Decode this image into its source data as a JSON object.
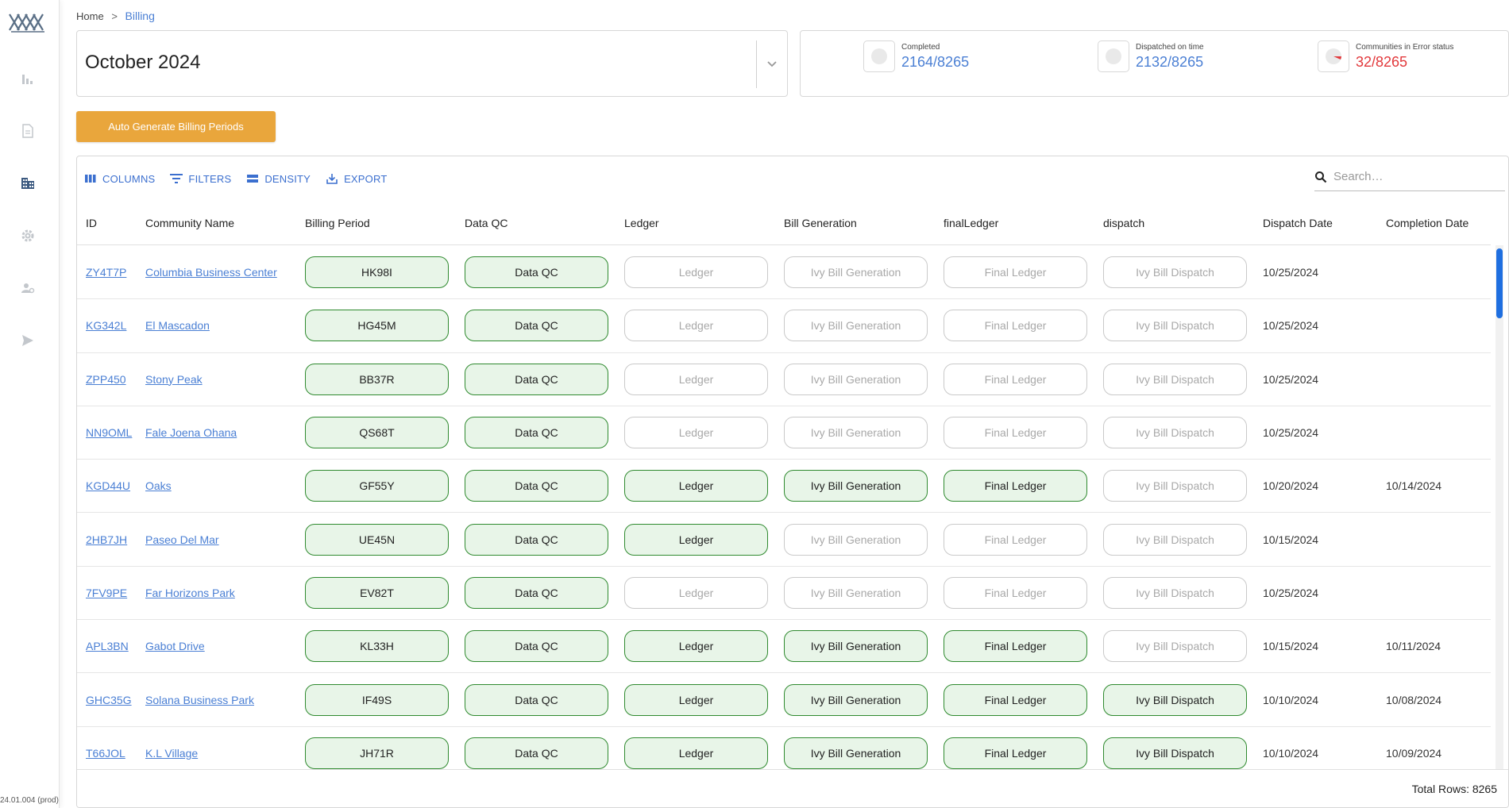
{
  "app": {
    "version": "24.01.004 (prod)"
  },
  "sidebar": {
    "items": [
      {
        "icon": "bar-chart-icon"
      },
      {
        "icon": "document-icon"
      },
      {
        "icon": "building-icon"
      },
      {
        "icon": "gear-icon"
      },
      {
        "icon": "user-settings-icon"
      },
      {
        "icon": "send-icon"
      }
    ]
  },
  "breadcrumb": {
    "home": "Home",
    "separator": ">",
    "current": "Billing"
  },
  "period": {
    "selected": "October 2024"
  },
  "stats": {
    "completed": {
      "label": "Completed",
      "value": "2164/8265"
    },
    "dispatched": {
      "label": "Dispatched on time",
      "value": "2132/8265"
    },
    "errors": {
      "label": "Communities in Error status",
      "value": "32/8265"
    }
  },
  "actions": {
    "auto_generate": "Auto Generate Billing Periods"
  },
  "toolbar": {
    "columns": "COLUMNS",
    "filters": "FILTERS",
    "density": "DENSITY",
    "export": "EXPORT",
    "search_placeholder": "Search…"
  },
  "columns": {
    "id": "ID",
    "community": "Community Name",
    "billing_period": "Billing Period",
    "data_qc": "Data QC",
    "ledger": "Ledger",
    "bill_generation": "Bill Generation",
    "final_ledger": "finalLedger",
    "dispatch": "dispatch",
    "dispatch_date": "Dispatch Date",
    "completion_date": "Completion Date"
  },
  "chip_labels": {
    "data_qc": "Data QC",
    "ledger": "Ledger",
    "bill_generation": "Ivy Bill Generation",
    "final_ledger": "Final Ledger",
    "dispatch": "Ivy Bill Dispatch"
  },
  "rows": [
    {
      "id": "ZY4T7P",
      "name": "Columbia Business Center",
      "period": "HK98I",
      "status": [
        true,
        false,
        false,
        false,
        false
      ],
      "dispatch_date": "10/25/2024",
      "completion_date": ""
    },
    {
      "id": "KG342L",
      "name": "El Mascadon",
      "period": "HG45M",
      "status": [
        true,
        false,
        false,
        false,
        false
      ],
      "dispatch_date": "10/25/2024",
      "completion_date": ""
    },
    {
      "id": "ZPP450",
      "name": "Stony Peak",
      "period": "BB37R",
      "status": [
        true,
        false,
        false,
        false,
        false
      ],
      "dispatch_date": "10/25/2024",
      "completion_date": ""
    },
    {
      "id": "NN9OML",
      "name": "Fale Joena Ohana",
      "period": "QS68T",
      "status": [
        true,
        false,
        false,
        false,
        false
      ],
      "dispatch_date": "10/25/2024",
      "completion_date": ""
    },
    {
      "id": "KGD44U",
      "name": "Oaks",
      "period": "GF55Y",
      "status": [
        true,
        true,
        true,
        true,
        false
      ],
      "dispatch_date": "10/20/2024",
      "completion_date": "10/14/2024"
    },
    {
      "id": "2HB7JH",
      "name": "Paseo Del Mar",
      "period": "UE45N",
      "status": [
        true,
        true,
        false,
        false,
        false
      ],
      "dispatch_date": "10/15/2024",
      "completion_date": ""
    },
    {
      "id": "7FV9PE",
      "name": "Far Horizons Park",
      "period": "EV82T",
      "status": [
        true,
        false,
        false,
        false,
        false
      ],
      "dispatch_date": "10/25/2024",
      "completion_date": ""
    },
    {
      "id": "APL3BN",
      "name": "Gabot Drive",
      "period": "KL33H",
      "status": [
        true,
        true,
        true,
        true,
        false
      ],
      "dispatch_date": "10/15/2024",
      "completion_date": "10/11/2024"
    },
    {
      "id": "GHC35G",
      "name": "Solana Business Park",
      "period": "IF49S",
      "status": [
        true,
        true,
        true,
        true,
        true
      ],
      "dispatch_date": "10/10/2024",
      "completion_date": "10/08/2024"
    },
    {
      "id": "T66JOL",
      "name": "K.L Village",
      "period": "JH71R",
      "status": [
        true,
        true,
        true,
        true,
        true
      ],
      "dispatch_date": "10/10/2024",
      "completion_date": "10/09/2024"
    }
  ],
  "footer": {
    "total_rows": "Total Rows: 8265"
  },
  "colors": {
    "accent": "#4a7fd4",
    "button": "#e9a63c",
    "error": "#e2383b",
    "chip_active_border": "#2f8a2f",
    "chip_active_bg": "#e8f5e8"
  }
}
